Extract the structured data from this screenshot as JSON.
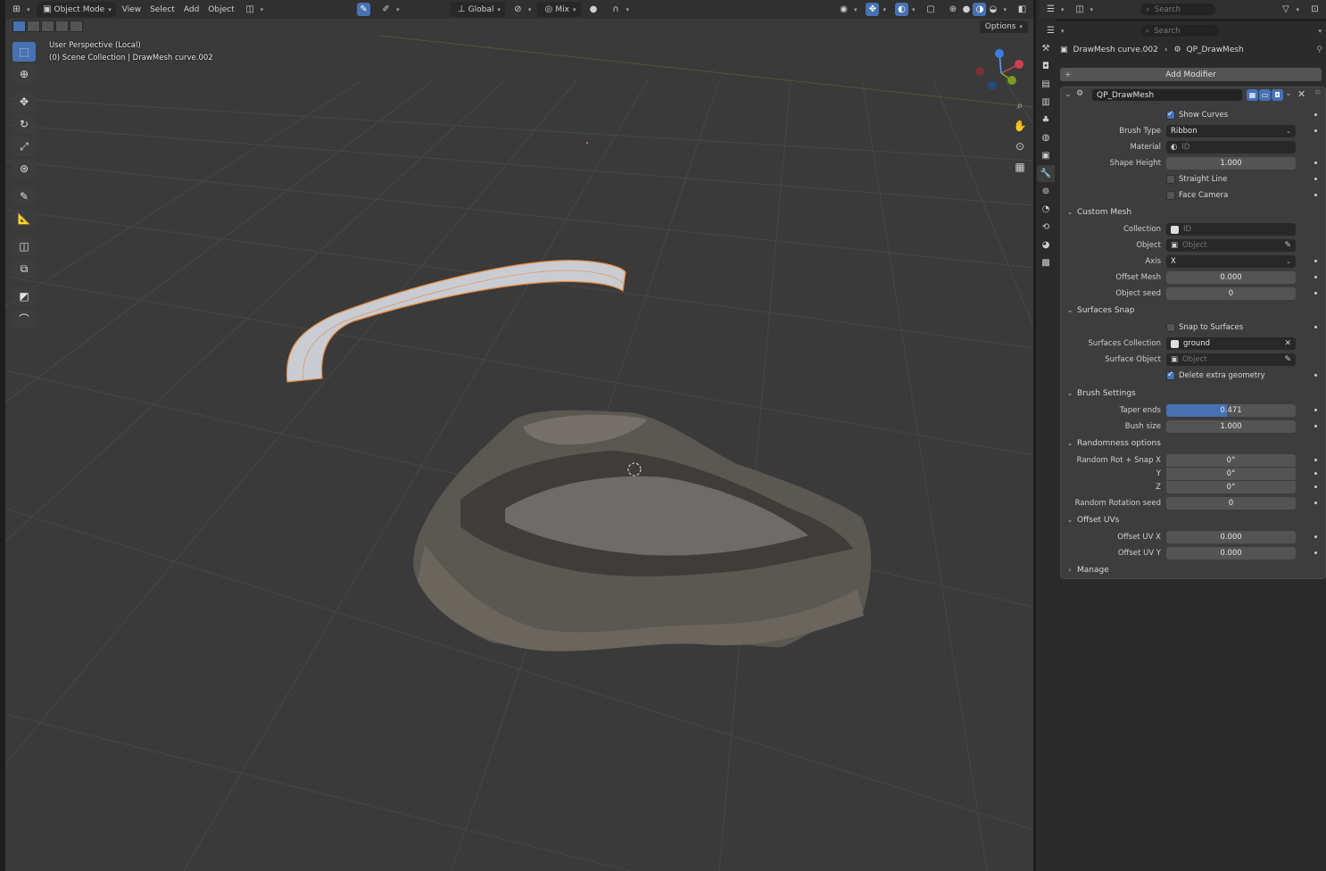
{
  "viewport": {
    "header": {
      "mode": "Object Mode",
      "menus": [
        "View",
        "Select",
        "Add",
        "Object"
      ],
      "transform_orientation": "Global",
      "snap_mode": "Mix"
    },
    "options_label": "Options",
    "info_line1": "User Perspective (Local)",
    "info_line2": "(0) Scene Collection | DrawMesh curve.002"
  },
  "right": {
    "search_placeholder_top": "Search",
    "search_placeholder_props": "Search",
    "breadcrumb_object": "DrawMesh curve.002",
    "breadcrumb_modifier": "QP_DrawMesh",
    "add_modifier": "Add Modifier",
    "modifier_name": "QP_DrawMesh"
  },
  "modifier": {
    "show_curves": "Show Curves",
    "brush_type_label": "Brush Type",
    "brush_type_value": "Ribbon",
    "material_label": "Material",
    "material_placeholder": "ID",
    "shape_height_label": "Shape Height",
    "shape_height_value": "1.000",
    "straight_line": "Straight Line",
    "face_camera": "Face Camera",
    "custom_mesh": {
      "title": "Custom Mesh",
      "collection_label": "Collection",
      "collection_placeholder": "ID",
      "object_label": "Object",
      "object_placeholder": "Object",
      "axis_label": "Axis",
      "axis_value": "X",
      "offset_mesh_label": "Offset Mesh",
      "offset_mesh_value": "0.000",
      "object_seed_label": "Object seed",
      "object_seed_value": "0"
    },
    "surfaces_snap": {
      "title": "Surfaces Snap",
      "snap_to_surfaces": "Snap to Surfaces",
      "surfaces_collection_label": "Surfaces Collection",
      "surfaces_collection_value": "ground",
      "surface_object_label": "Surface Object",
      "surface_object_placeholder": "Object",
      "delete_extra": "Delete extra geometry"
    },
    "brush_settings": {
      "title": "Brush Settings",
      "taper_ends_label": "Taper ends",
      "taper_ends_value": "0.471",
      "taper_ends_fraction": 0.471,
      "bush_size_label": "Bush size",
      "bush_size_value": "1.000"
    },
    "randomness": {
      "title": "Randomness options",
      "rot_x_label": "Random Rot + Snap X",
      "rot_x_value": "0°",
      "rot_y_label": "Y",
      "rot_y_value": "0°",
      "rot_z_label": "Z",
      "rot_z_value": "0°",
      "seed_label": "Random Rotation seed",
      "seed_value": "0"
    },
    "offset_uvs": {
      "title": "Offset UVs",
      "uv_x_label": "Offset UV X",
      "uv_x_value": "0.000",
      "uv_y_label": "Offset UV Y",
      "uv_y_value": "0.000"
    },
    "manage": "Manage"
  },
  "colors": {
    "accent": "#4772b3",
    "viewport_bg": "#3a3a3a",
    "selection_outline": "#e8893a"
  }
}
